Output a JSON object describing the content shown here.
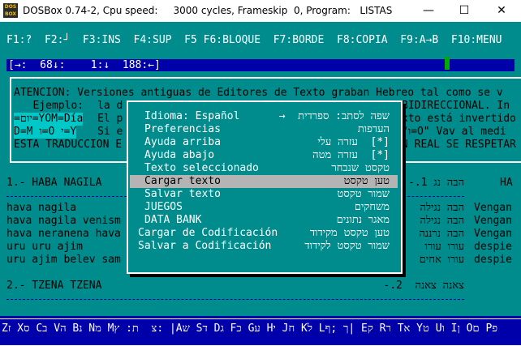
{
  "window": {
    "title": "DOSBox 0.74-2, Cpu speed:     3000 cycles, Frameskip  0, Program:   LISTAS",
    "icon_label": "DOS BOX",
    "minimize": "—",
    "maximize": "☐",
    "close": "✕"
  },
  "fkeys": "F1:?  F2:┘  F3:INS  F4:SUP  F5 F6:BLOQUE  F7:BORDE  F8:COPIA  F9:A→B  F10:MENU",
  "status": "[→:  68↓:    1:↓  188:←]",
  "info": {
    "line1": "ATENCION: Versiones antiguas de Editores de Texto graban Hebreo tal como se v",
    "line2_a": "   Ejemplo:",
    "line2_b": "la d",
    "line2_c": "BIDIRECCIONAL. In",
    "line3_a": "=יום=YOM=Día",
    "line3_b": "El p",
    "line3_c": "xto está invertido",
    "line4_a": "D=M ו=O י=Y",
    "line4_b": "Si e",
    "line4_c": "\"ו=O\" Vav al medi",
    "line5_a": "ESTA TRADUCCION E",
    "line5_c": "N REAL SE RESPETAR"
  },
  "songs": {
    "title1_left": "1.- HABA NAGILA",
    "title1_right": "הבה נג 1.-",
    "title1_far": "HA",
    "lines_left": [
      "hava nagila",
      "hava nagila venism",
      "hava neranena hava",
      "uru uru ajim",
      "uru ajim belev sam"
    ],
    "lines_right": [
      "הבה נגילה",
      "הבה נגילה",
      "הבה נרננה",
      "עורו עורו",
      "עורו אחים"
    ],
    "lines_far": [
      "Vengan",
      "Vengan",
      "Vengan",
      "despie",
      "despie"
    ],
    "title2_left": "2.- TZENA TZENA",
    "title2_right": "צאנה צאנה  2.-"
  },
  "menu": {
    "items": [
      {
        "left": "Idioma: Español",
        "right": "שפה לסתב: ספרדית  →"
      },
      {
        "left": "Preferencias",
        "right": "העדפות"
      },
      {
        "left": "Ayuda arriba",
        "right": "[*]  עזרה עלי"
      },
      {
        "left": "Ayuda abajo",
        "right": "[*]  עזרה מטה"
      },
      {
        "left": "Texto seleccionado",
        "right": "טקסט שנבחר"
      },
      {
        "left": "Cargar texto",
        "right": "טען טקסט"
      },
      {
        "left": "Salvar texto",
        "right": "שמור טקסט"
      },
      {
        "left": "JUEGOS",
        "right": "משחקים"
      },
      {
        "left": "DATA BANK",
        "right": "מאגר נתונים"
      },
      {
        "left": "Cargar de Codificación",
        "right": "טען טקסט מקידוד"
      },
      {
        "left": "Salvar a Codificación",
        "right": "שמור טקסט לקידוד"
      }
    ],
    "selected_index": 5
  },
  "keyboard": "Zז Xס Cב Vה Bנ Nמ Mצ  ת: ץ: |Aש Sד Dג Fכ Gע Hי Jח Kל Lך ;ף| Eק Rר Tא Yט Uו Iן Oם Pפ"
}
